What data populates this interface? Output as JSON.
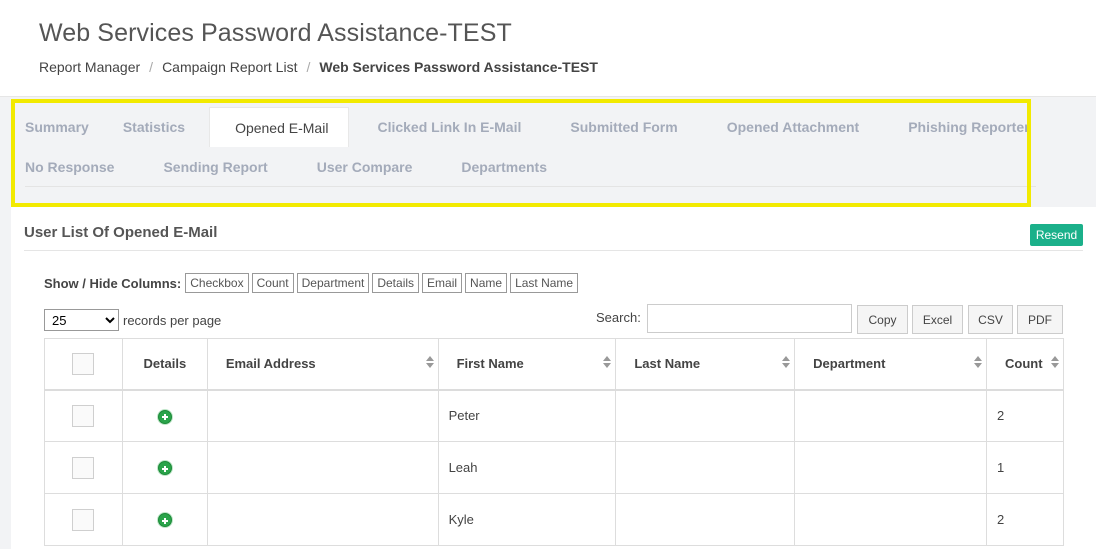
{
  "header": {
    "title": "Web Services Password Assistance-TEST",
    "breadcrumb": {
      "items": [
        "Report Manager",
        "Campaign Report List"
      ],
      "separator": "/",
      "current": "Web Services Password Assistance-TEST"
    }
  },
  "tabs": {
    "row1": [
      "Summary",
      "Statistics",
      "Opened E-Mail",
      "Clicked Link In E-Mail",
      "Submitted Form",
      "Opened Attachment",
      "Phishing Reporter"
    ],
    "row2": [
      "No Response",
      "Sending Report",
      "User Compare",
      "Departments"
    ],
    "active": "Opened E-Mail"
  },
  "section": {
    "title": "User List Of Opened E-Mail",
    "resend_label": "Resend"
  },
  "columns_toggle": {
    "label": "Show / Hide Columns:",
    "buttons": [
      "Checkbox",
      "Count",
      "Department",
      "Details",
      "Email",
      "Name",
      "Last Name"
    ]
  },
  "length": {
    "value": "25",
    "suffix": "records per page"
  },
  "search": {
    "label": "Search:",
    "value": ""
  },
  "export_buttons": [
    "Copy",
    "Excel",
    "CSV",
    "PDF"
  ],
  "table": {
    "headers": [
      "",
      "Details",
      "Email Address",
      "First Name",
      "Last Name",
      "Department",
      "Count"
    ],
    "rows": [
      {
        "email": "",
        "first_name": "Peter",
        "last_name": "",
        "department": "",
        "count": "2"
      },
      {
        "email": "",
        "first_name": "Leah",
        "last_name": "",
        "department": "",
        "count": "1"
      },
      {
        "email": "",
        "first_name": "Kyle",
        "last_name": "",
        "department": "",
        "count": "2"
      }
    ]
  },
  "colors": {
    "highlight": "#f2ea00",
    "resend": "#1bb08a",
    "details_icon": "#2aa44a",
    "tab_inactive": "#a4abba"
  }
}
